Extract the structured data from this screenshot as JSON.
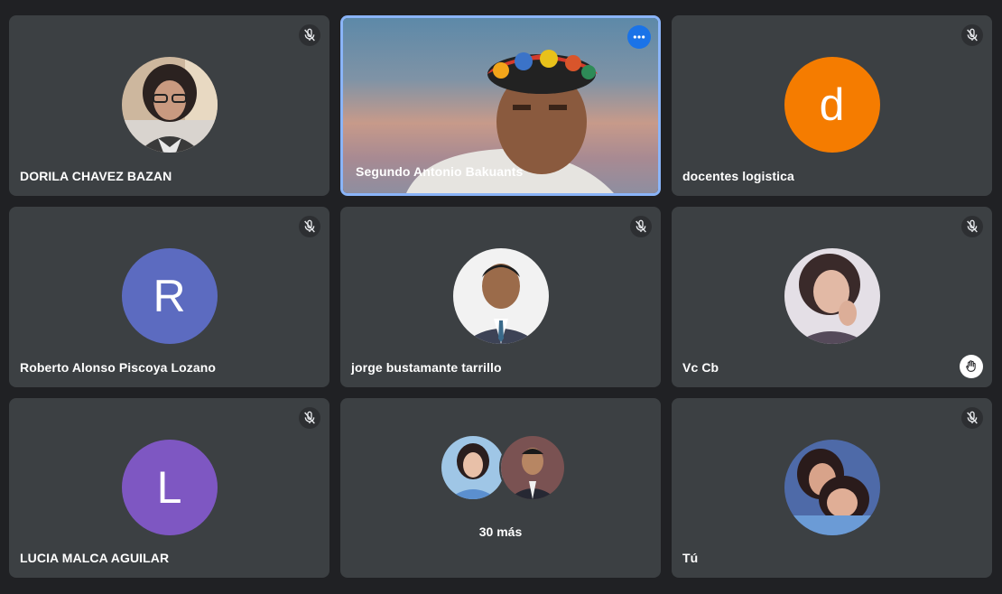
{
  "participants": [
    {
      "name": "DORILA CHAVEZ BAZAN",
      "avatar": "photo-woman-glasses-icon",
      "muted": true
    },
    {
      "name": "Segundo Antonio Bakuants",
      "avatar": "video-feed",
      "active_speaker": true,
      "more_options_icon": "more-horizontal-icon"
    },
    {
      "name": "docentes logistica",
      "avatar_letter": "d",
      "avatar_color": "#f57c00",
      "muted": true
    },
    {
      "name": "Roberto Alonso Piscoya Lozano",
      "avatar_letter": "R",
      "avatar_color": "#5c6bc0",
      "muted": true
    },
    {
      "name": "jorge bustamante tarrillo",
      "avatar": "photo-man-suit-icon",
      "muted": true
    },
    {
      "name": "Vc Cb",
      "avatar": "photo-woman-selfie-icon",
      "muted": true,
      "hand_raised": true
    },
    {
      "name": "LUCIA MALCA AGUILAR",
      "avatar_letter": "L",
      "avatar_color": "#7e57c2",
      "muted": true
    },
    {
      "group_label": "30 más",
      "avatars": [
        "photo-woman-icon",
        "photo-man-icon"
      ]
    },
    {
      "name": "Tú",
      "avatar": "photo-two-girls-icon",
      "muted": true
    }
  ],
  "colors": {
    "background": "#202124",
    "tile": "#3c4043",
    "active_border": "#8ab4f8",
    "accent_blue": "#1a73e8"
  }
}
